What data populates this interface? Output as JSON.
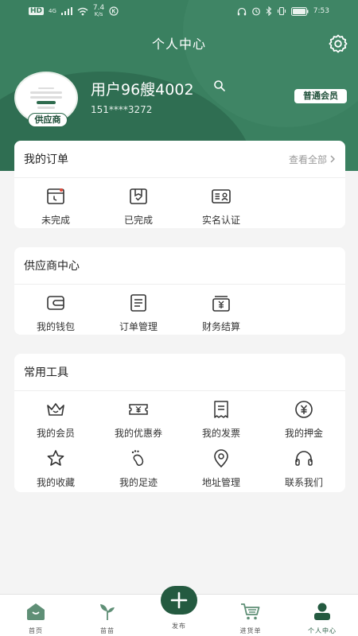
{
  "status_bar": {
    "network": "HD",
    "signal": "4G",
    "speed": "7.4",
    "speed_unit": "K/s",
    "time": "7:53"
  },
  "header": {
    "title": "个人中心",
    "username": "用户96艘4002",
    "phone": "151****3272",
    "supplier_tag": "供应商",
    "member_badge": "普通会员"
  },
  "orders": {
    "title": "我的订单",
    "view_all": "查看全部",
    "items": [
      {
        "label": "未完成",
        "icon": "pending-order-icon"
      },
      {
        "label": "已完成",
        "icon": "completed-order-icon"
      },
      {
        "label": "实名认证",
        "icon": "id-card-icon"
      }
    ]
  },
  "supplier": {
    "title": "供应商中心",
    "items": [
      {
        "label": "我的钱包",
        "icon": "wallet-icon"
      },
      {
        "label": "订单管理",
        "icon": "order-list-icon"
      },
      {
        "label": "财务结算",
        "icon": "finance-icon"
      }
    ]
  },
  "tools": {
    "title": "常用工具",
    "items": [
      {
        "label": "我的会员",
        "icon": "crown-icon"
      },
      {
        "label": "我的优惠券",
        "icon": "coupon-icon"
      },
      {
        "label": "我的发票",
        "icon": "invoice-icon"
      },
      {
        "label": "我的押金",
        "icon": "deposit-icon"
      },
      {
        "label": "我的收藏",
        "icon": "star-icon"
      },
      {
        "label": "我的足迹",
        "icon": "footprint-icon"
      },
      {
        "label": "地址管理",
        "icon": "location-icon"
      },
      {
        "label": "联系我们",
        "icon": "headset-icon"
      }
    ]
  },
  "tabbar": {
    "home": "首页",
    "seedling": "苗苗",
    "publish": "发布",
    "cart": "进货单",
    "profile": "个人中心"
  },
  "colors": {
    "brand": "#3a8060",
    "brand_dark": "#245a40",
    "background": "#f4f4f4"
  }
}
